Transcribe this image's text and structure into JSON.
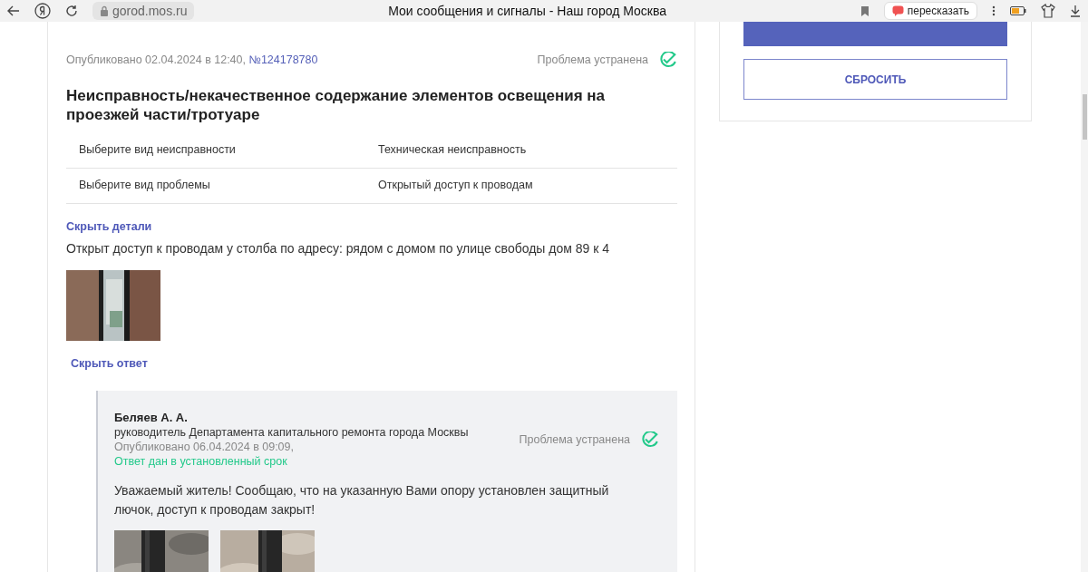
{
  "browser": {
    "url": "gorod.mos.ru",
    "title": "Мои сообщения и сигналы - Наш город Москва",
    "retell_label": "пересказать"
  },
  "message": {
    "published": "Опубликовано 02.04.2024 в 12:40, ",
    "number": "№124178780",
    "status": "Проблема устранена",
    "title": "Неисправность/некачественное содержание элементов освещения на проезжей части/тротуаре",
    "fields": [
      {
        "label": "Выберите вид неисправности",
        "value": "Техническая неисправность"
      },
      {
        "label": "Выберите вид проблемы",
        "value": "Открытый доступ к проводам"
      }
    ],
    "details_link": "Скрыть детали",
    "description": "Открыт доступ к проводам у столба по адресу: рядом с домом по улице свободы дом 89 к 4",
    "answer_link": "Скрыть ответ"
  },
  "reply": {
    "author": "Беляев А. А.",
    "position": "руководитель Департамента капитального ремонта города Москвы",
    "published": "Опубликовано 06.04.2024 в 09:09,",
    "deadline": "Ответ дан в установленный срок",
    "status": "Проблема устранена",
    "text": "Уважаемый житель! Сообщаю, что на указанную Вами опору установлен защитный лючок, доступ к проводам закрыт!"
  },
  "filter": {
    "reset_button": "СБРОСИТЬ"
  }
}
